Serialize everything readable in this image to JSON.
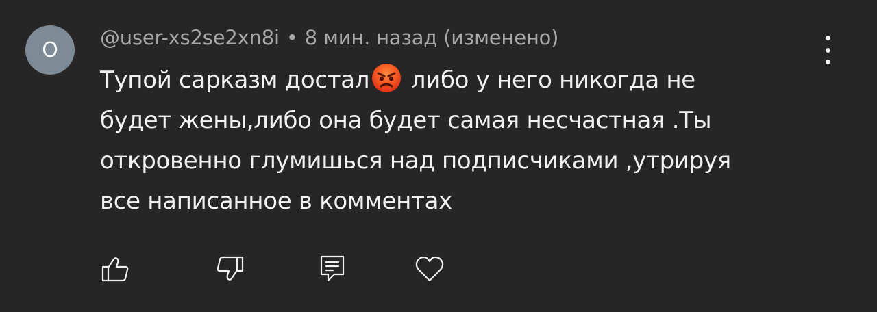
{
  "comment": {
    "avatar_letter": "O",
    "author": "@user-xs2se2xn8i",
    "separator": "•",
    "time": "8 мин. назад (изменено)",
    "text_lines": [
      "Тупой сарказм достал",
      " либо у него никогда не",
      "будет жены,либо она будет самая несчастная .Ты",
      "откровенно глумишься над подписчиками ,утрируя",
      "все написанное в комментах"
    ],
    "emoji": "angry-face-emoji"
  },
  "actions": {
    "like": "thumb-up-icon",
    "dislike": "thumb-down-icon",
    "reply": "reply-icon",
    "heart": "heart-icon"
  },
  "colors": {
    "background": "#262626",
    "avatar": "#7d8b96",
    "meta_text": "#a8a8a8",
    "body_text": "#f1f1f1"
  }
}
